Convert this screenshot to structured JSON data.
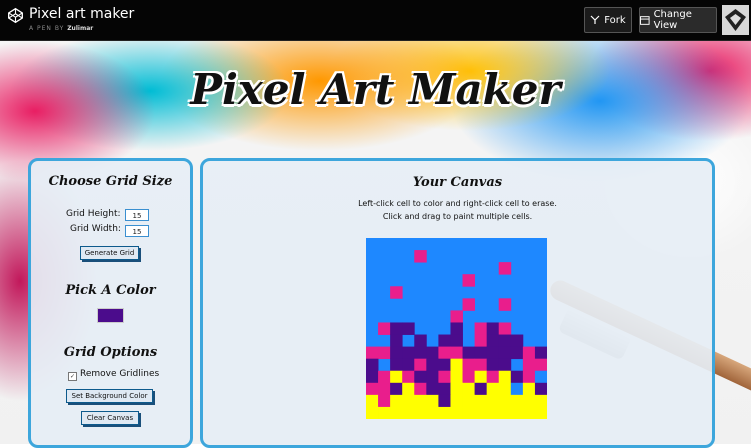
{
  "topbar": {
    "title": "Pixel art maker",
    "by_prefix": "A PEN BY",
    "author": "Zulimar",
    "fork_label": "Fork",
    "change_view_label": "Change View"
  },
  "page": {
    "title": "Pixel Art Maker"
  },
  "left": {
    "grid_size_heading": "Choose Grid Size",
    "grid_height_label": "Grid Height:",
    "grid_height_value": "15",
    "grid_width_label": "Grid Width:",
    "grid_width_value": "15",
    "generate_label": "Generate Grid",
    "color_heading": "Pick A Color",
    "color_value": "#4b0c8c",
    "options_heading": "Grid Options",
    "remove_gridlines_label": "Remove Gridlines",
    "remove_gridlines_checked": true,
    "set_bg_label": "Set Background Color",
    "clear_label": "Clear Canvas"
  },
  "right": {
    "heading": "Your Canvas",
    "instruction_1": "Left-click cell to color and right-click cell to erase.",
    "instruction_2": "Click and drag to paint multiple cells."
  },
  "canvas": {
    "background": "#1e88ff",
    "colors": {
      "P": "#e91e8c",
      "V": "#4b0c8c",
      "Y": "#ffff00",
      "B": "#1e88ff"
    },
    "rows": [
      "...............",
      "....P..........",
      "...........P...",
      "........P......",
      "..P............",
      "........P..P...",
      ".......P.......",
      ".PVV...V.PVP...",
      "..V.V.VV.PVVV..",
      "PPVVVVPPVVVVVPV",
      "V.VVPVVYPPVV.PP",
      "VPYPVVPYPYPYVPB",
      "PPVYPVVYYVYYBYV",
      "YPYYYYVYYYYYYYY",
      "YYYYYYYYYYYYYYY"
    ]
  }
}
